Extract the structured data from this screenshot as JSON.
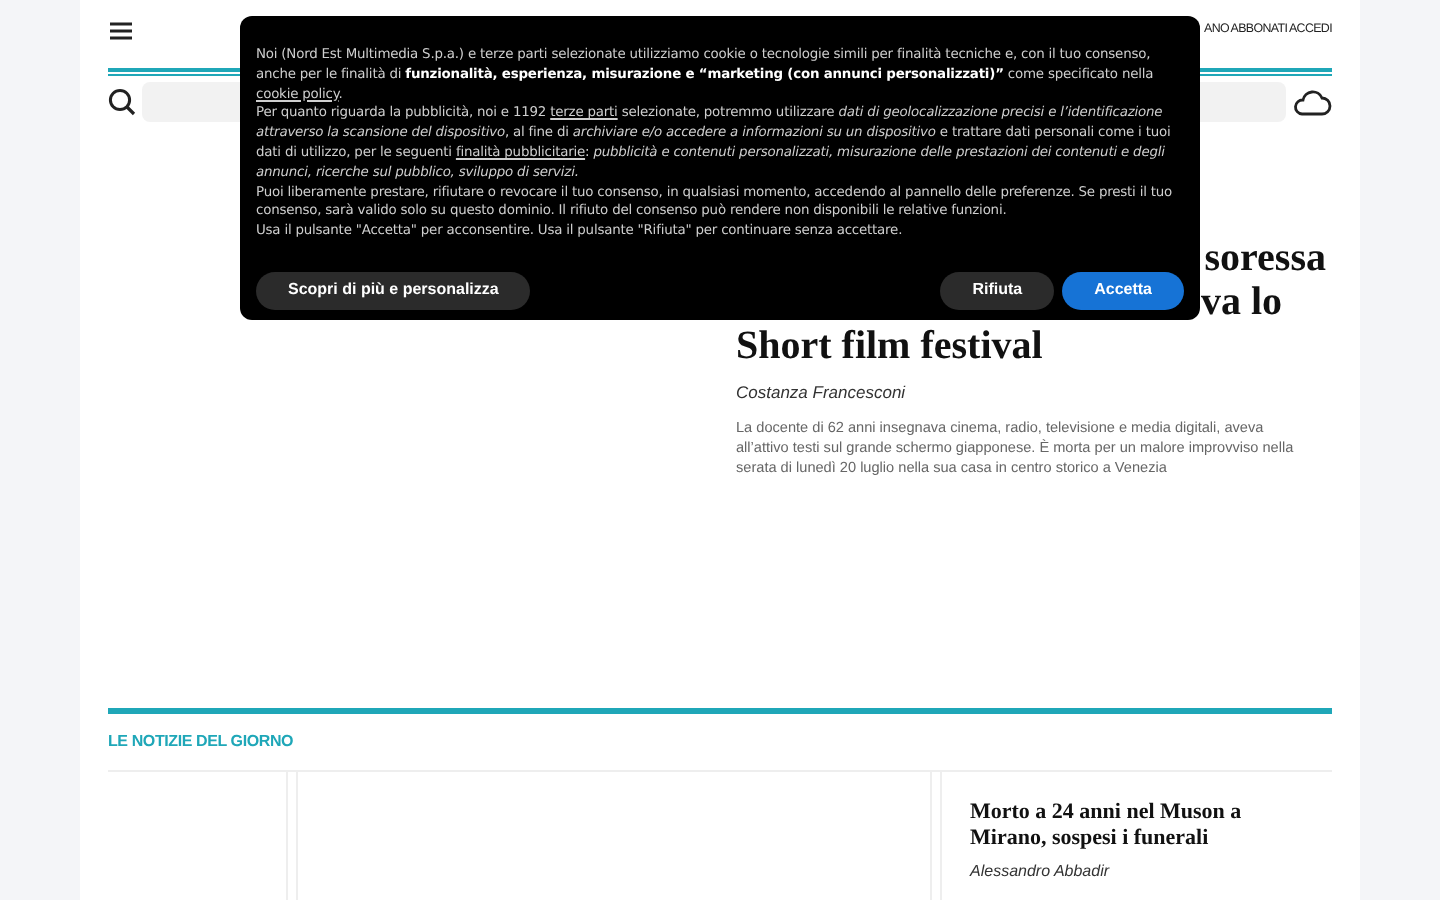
{
  "header": {
    "links": [
      "ANO",
      "ABBONATI",
      "ACCEDI"
    ]
  },
  "article": {
    "headline_lines": [
      "soressa",
      "va lo",
      "Short film festival"
    ],
    "author": "Costanza Francesconi",
    "summary": "La docente di 62 anni insegnava cinema, radio, televisione e media digitali, aveva all’attivo testi sul grande schermo giapponese. È morta per un malore improvviso nella serata di lunedì 20 luglio nella sua casa in centro storico a Venezia"
  },
  "section": {
    "title": "LE NOTIZIE DEL GIORNO",
    "card": {
      "headline": "Morto a 24 anni nel Muson a Mirano, sospesi i funerali",
      "author": "Alessandro Abbadir"
    }
  },
  "cookie_dialog": {
    "paragraphs": [
      {
        "parts": [
          {
            "kind": "text",
            "text": "Noi (Nord Est Multimedia S.p.a.) e terze parti selezionate utilizziamo cookie o tecnologie simili per finalità tecniche e, con il tuo consenso, anche per le finalità di **funzionalità, esperienza, misurazione e “marketing (con annunci personalizzati)”** come specificato nella "
          },
          {
            "kind": "link",
            "text": "cookie policy"
          },
          {
            "kind": "text",
            "text": "."
          }
        ]
      },
      {
        "parts": [
          {
            "kind": "text",
            "text": "Per quanto riguarda la pubblicità, noi e 1192 "
          },
          {
            "kind": "link",
            "text": "terze parti"
          },
          {
            "kind": "text",
            "text": " selezionate, potremmo utilizzare *dati di geolocalizzazione precisi e l’identificazione attraverso la scansione del dispositivo*, al fine di *archiviare e/o accedere a informazioni su un dispositivo* e trattare dati personali come i tuoi dati di utilizzo, per le seguenti "
          },
          {
            "kind": "link",
            "text": "finalità pubblicitarie"
          },
          {
            "kind": "text",
            "text": ": *pubblicità e contenuti personalizzati, misurazione delle prestazioni dei contenuti e degli annunci, ricerche sul pubblico, sviluppo di servizi.*"
          }
        ]
      },
      {
        "parts": [
          {
            "kind": "text",
            "text": "Puoi liberamente prestare, rifiutare o revocare il tuo consenso, in qualsiasi momento, accedendo al pannello delle preferenze. Se presti il tuo consenso, sarà valido solo su questo dominio. Il rifiuto del consenso può rendere non disponibili le relative funzioni."
          }
        ]
      },
      {
        "parts": [
          {
            "kind": "text",
            "text": "Usa il pulsante \"Accetta\" per acconsentire. Usa il pulsante \"Rifiuta\" per continuare senza accettare."
          }
        ]
      }
    ],
    "buttons": [
      {
        "label": "Scopri di più e personalizza",
        "kind": "secondary"
      },
      {
        "label": "Rifiuta",
        "kind": "secondary"
      },
      {
        "label": "Accetta",
        "kind": "primary"
      }
    ]
  }
}
